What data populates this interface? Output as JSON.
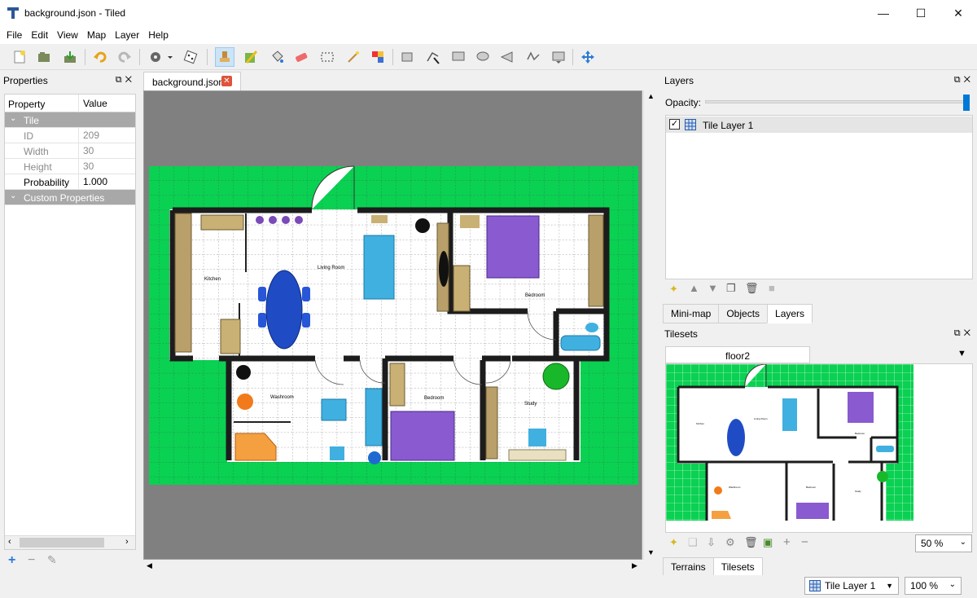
{
  "window": {
    "title": "background.json - Tiled",
    "minimize": "—",
    "maximize": "☐",
    "close": "✕"
  },
  "menu": [
    "File",
    "Edit",
    "View",
    "Map",
    "Layer",
    "Help"
  ],
  "toolbar": {
    "icons": [
      "new-file-icon",
      "open-file-icon",
      "save-file-icon",
      "undo-icon",
      "redo-icon",
      "commands-icon",
      "random-mode-icon",
      "stamp-brush-icon",
      "terrain-brush-icon",
      "bucket-fill-icon",
      "eraser-icon",
      "rectangle-select-icon",
      "magic-wand-icon",
      "select-same-tile-icon",
      "select-objects-icon",
      "edit-polygons-icon",
      "insert-rectangle-icon",
      "insert-ellipse-icon",
      "insert-polygon-icon",
      "insert-polyline-icon",
      "insert-tile-icon",
      "move-icon"
    ]
  },
  "properties": {
    "panel_title": "Properties",
    "header_property": "Property",
    "header_value": "Value",
    "group_tile": "Tile",
    "rows": [
      {
        "key": "ID",
        "value": "209"
      },
      {
        "key": "Width",
        "value": "30"
      },
      {
        "key": "Height",
        "value": "30"
      },
      {
        "key": "Probability",
        "value": "1.000"
      }
    ],
    "group_custom": "Custom Properties"
  },
  "document_tab": {
    "label": "background.json",
    "close": "✕"
  },
  "floorplan": {
    "labels": {
      "kitchen": "Kitchen",
      "living": "Living Room",
      "bedroom1": "Bedroom",
      "washroom": "Washroom",
      "bedroom2": "Bedroom",
      "study": "Study"
    }
  },
  "layers": {
    "panel_title": "Layers",
    "opacity_label": "Opacity:",
    "opacity_value": 1.0,
    "items": [
      {
        "name": "Tile Layer 1",
        "visible": true
      }
    ],
    "tabs": [
      "Mini-map",
      "Objects",
      "Layers"
    ],
    "selected_tab": "Layers"
  },
  "tilesets": {
    "panel_title": "Tilesets",
    "current": "floor2",
    "zoom": "50 %",
    "thumb_labels": {
      "kitchen": "Kitchen",
      "living": "Living Room",
      "bedroom1": "Bedroom",
      "washroom": "Washroom",
      "bedroom2": "Bedroom",
      "study": "Study"
    },
    "tabs": [
      "Terrains",
      "Tilesets"
    ],
    "selected_tab": "Tilesets"
  },
  "statusbar": {
    "layer": "Tile Layer 1",
    "zoom": "100 %"
  },
  "colors": {
    "grass": "#0ad152",
    "canvas_bg": "#808080",
    "wall": "#1c1c1c",
    "group_row": "#a8a8a8",
    "accent": "#0078d7"
  }
}
